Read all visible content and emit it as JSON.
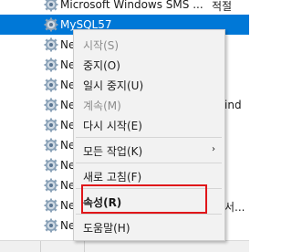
{
  "services": {
    "rows": [
      {
        "name": "Microsoft Windows SMS ...",
        "right": "적절"
      },
      {
        "name": "MySQL57",
        "right": ""
      },
      {
        "name": "Net",
        "right": ""
      },
      {
        "name": "Net",
        "right": ""
      },
      {
        "name": "Net",
        "right": ""
      },
      {
        "name": "Net",
        "right": "ind"
      },
      {
        "name": "Net",
        "right": ""
      },
      {
        "name": "Net",
        "right": ""
      },
      {
        "name": "Net",
        "right": ""
      },
      {
        "name": "Net",
        "right": ""
      },
      {
        "name": "Net",
        "right": "서..."
      },
      {
        "name": "Net",
        "right": ""
      }
    ],
    "selected_index": 1
  },
  "context_menu": {
    "items": [
      {
        "label": "시작(S)",
        "enabled": false
      },
      {
        "label": "중지(O)",
        "enabled": true
      },
      {
        "label": "일시 중지(U)",
        "enabled": true
      },
      {
        "label": "계속(M)",
        "enabled": false
      },
      {
        "label": "다시 시작(E)",
        "enabled": true
      },
      {
        "label": "모든 작업(K)",
        "enabled": true,
        "submenu": true
      },
      {
        "label": "새로 고침(F)",
        "enabled": true
      },
      {
        "label": "속성(R)",
        "enabled": true,
        "bold": true,
        "highlighted": true
      },
      {
        "label": "도움말(H)",
        "enabled": true
      }
    ],
    "submenu_arrow": "›"
  },
  "colors": {
    "selection": "#0078d7",
    "highlight_box": "#e0161a",
    "menu_bg": "#f2f2f2"
  },
  "icons": {
    "service": "gear-icon"
  }
}
